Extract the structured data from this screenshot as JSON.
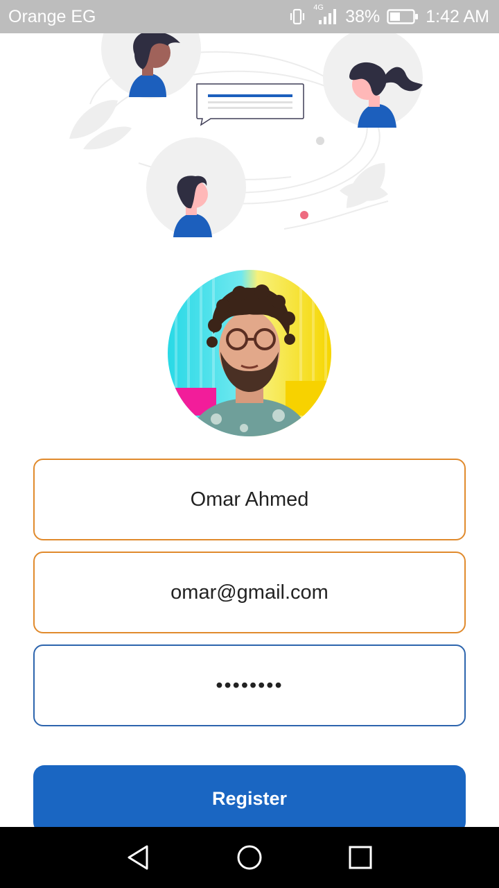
{
  "status_bar": {
    "carrier": "Orange EG",
    "network_label": "4G",
    "battery_percent": "38%",
    "time": "1:42 AM"
  },
  "illustration": {
    "icon": "chat-people-illustration"
  },
  "profile": {
    "avatar_icon": "profile-photo"
  },
  "form": {
    "name_value": "Omar Ahmed",
    "email_value": "omar@gmail.com",
    "password_value": "••••••••",
    "register_label": "Register"
  },
  "colors": {
    "accent_blue": "#1a66c2",
    "input_border_orange": "#e08a2c",
    "input_border_focused": "#2c64ad",
    "status_bar_gray": "#bdbdbd"
  },
  "nav_bar": {
    "back_icon": "back-triangle-icon",
    "home_icon": "home-circle-icon",
    "recents_icon": "recents-square-icon"
  }
}
